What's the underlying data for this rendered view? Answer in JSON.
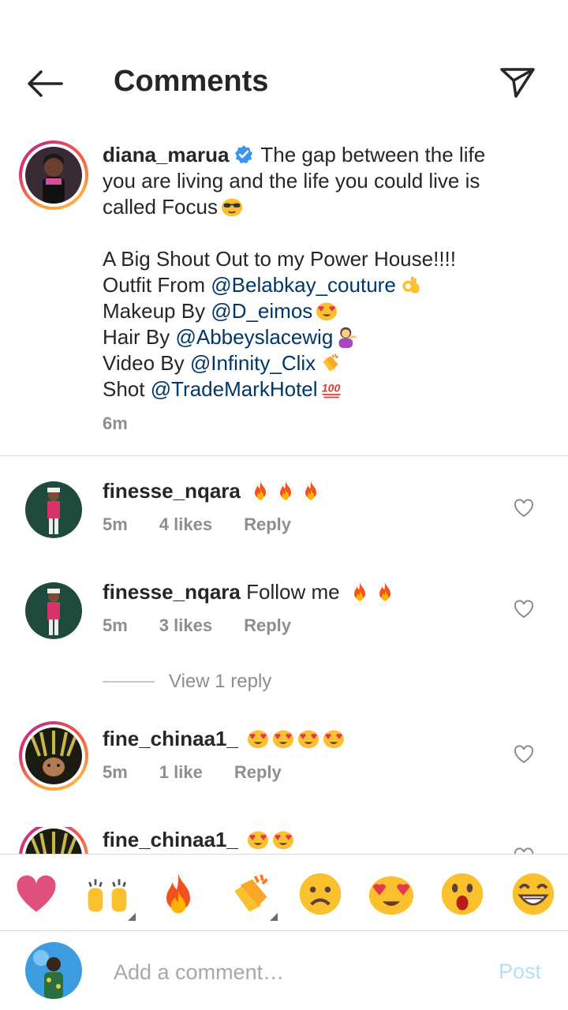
{
  "header": {
    "title": "Comments",
    "back_icon": "arrow-left-icon",
    "send_icon": "paper-plane-icon"
  },
  "caption": {
    "username": "diana_marua",
    "verified": true,
    "text_line1": "The gap between the life",
    "text_line2": "you are living and the life you could live is",
    "text_line3": "called Focus",
    "shout": "A Big Shout Out to my Power House!!!!",
    "outfit_prefix": "Outfit From ",
    "outfit_mention": "@Belabkay_couture",
    "makeup_prefix": "Makeup By ",
    "makeup_mention": "@D_eimos",
    "hair_prefix": "Hair By ",
    "hair_mention": "@Abbeyslacewig",
    "video_prefix": "Video By ",
    "video_mention": "@Infinity_Clix",
    "shot_prefix": "Shot ",
    "shot_mention": "@TradeMarkHotel",
    "time": "6m"
  },
  "comments": [
    {
      "username": "finesse_nqara",
      "text": "",
      "time": "5m",
      "likes": "4 likes",
      "reply": "Reply"
    },
    {
      "username": "finesse_nqara",
      "text": "Follow me",
      "time": "5m",
      "likes": "3 likes",
      "reply": "Reply"
    },
    {
      "username": "fine_chinaa1_",
      "text": "",
      "time": "5m",
      "likes": "1 like",
      "reply": "Reply"
    },
    {
      "username": "fine_chinaa1_",
      "text": ""
    }
  ],
  "view_replies": "View 1 reply",
  "emoji_bar": [
    "heart-emoji",
    "raised-hands-emoji",
    "fire-emoji",
    "clapping-emoji",
    "frowning-face-emoji",
    "heart-eyes-emoji",
    "surprised-face-emoji",
    "laughing-face-emoji"
  ],
  "composer": {
    "placeholder": "Add a comment…",
    "post_label": "Post"
  },
  "colors": {
    "mention": "#00376b",
    "verified": "#3897f0",
    "muted": "#8e8e8e",
    "post_disabled": "#b2dffc"
  }
}
